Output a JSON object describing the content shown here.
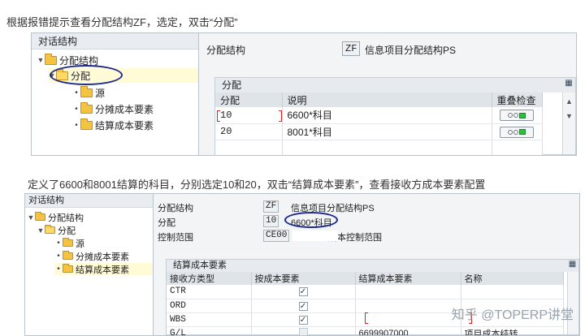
{
  "captions": {
    "top": "根据报错提示查看分配结构ZF，选定，双击“分配”",
    "middle": "定义了6600和8001结算的科目，分别选定10和20，双击“结算成本要素”，查看接收方成本要素配置"
  },
  "top_screen": {
    "tree_title": "对话结构",
    "tree": {
      "root": "分配结构",
      "selected": "分配",
      "children": [
        "源",
        "分摊成本要素",
        "结算成本要素"
      ]
    },
    "header": {
      "field_label": "分配结构",
      "key": "ZF",
      "description": "信息项目分配结构PS"
    },
    "group_title": "分配",
    "columns": [
      "分配",
      "说明",
      "重叠检查"
    ],
    "rows": [
      {
        "assignment": "10",
        "text": "6600*科目"
      },
      {
        "assignment": "20",
        "text": "8001*科目"
      }
    ]
  },
  "bottom_screen": {
    "tree_title": "对话结构",
    "tree": {
      "root": "分配结构",
      "level1": "分配",
      "children": [
        "源",
        "分摊成本要素",
        "结算成本要素"
      ],
      "selected": "结算成本要素"
    },
    "fields": {
      "structure_label": "分配结构",
      "structure_key": "ZF",
      "structure_desc": "信息项目分配结构PS",
      "assign_label": "分配",
      "assign_key": "10",
      "assign_desc": "6600*科目",
      "area_label": "控制范围",
      "area_key": "CE00",
      "area_desc": "成本控制范围"
    },
    "group_title": "结算成本要素",
    "columns": [
      "接收方类型",
      "按成本要素",
      "结算成本要素",
      "名称"
    ],
    "rows": [
      {
        "receiver": "CTR",
        "by_element": true,
        "element": "",
        "name": ""
      },
      {
        "receiver": "ORD",
        "by_element": true,
        "element": "",
        "name": ""
      },
      {
        "receiver": "WBS",
        "by_element": true,
        "element": "",
        "name": ""
      },
      {
        "receiver": "G/L",
        "by_element": false,
        "element": "6699907000",
        "name": "项目成本结转"
      }
    ]
  },
  "watermark": "知乎 @TOPERP讲堂"
}
